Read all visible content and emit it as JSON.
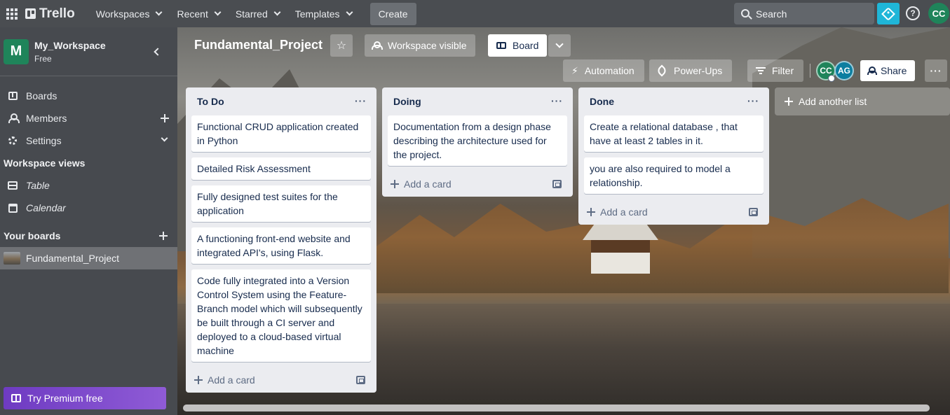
{
  "topnav": {
    "logo_text": "Trello",
    "menus": [
      "Workspaces",
      "Recent",
      "Starred",
      "Templates"
    ],
    "create_label": "Create",
    "search_placeholder": "Search",
    "user_initials": "CC"
  },
  "sidebar": {
    "workspace_initial": "M",
    "workspace_name": "My_Workspace",
    "workspace_plan": "Free",
    "items": [
      {
        "label": "Boards",
        "icon": "board-icon"
      },
      {
        "label": "Members",
        "icon": "members-icon"
      },
      {
        "label": "Settings",
        "icon": "gear-icon"
      }
    ],
    "views_title": "Workspace views",
    "views": [
      {
        "label": "Table",
        "icon": "table-icon"
      },
      {
        "label": "Calendar",
        "icon": "calendar-icon"
      }
    ],
    "boards_title": "Your boards",
    "boards": [
      {
        "label": "Fundamental_Project"
      }
    ],
    "premium_label": "Try Premium free"
  },
  "board": {
    "title": "Fundamental_Project",
    "visibility_label": "Workspace visible",
    "view_label": "Board",
    "automation_label": "Automation",
    "powerups_label": "Power-Ups",
    "filter_label": "Filter",
    "members": [
      "CC",
      "AG"
    ],
    "share_label": "Share",
    "more_label": "···",
    "add_list_label": "Add another list"
  },
  "lists": [
    {
      "title": "To Do",
      "cards": [
        "Functional CRUD application created in Python",
        "Detailed Risk Assessment",
        "Fully designed test suites for the application",
        "A functioning front-end website and integrated API's, using Flask.",
        "Code fully integrated into a Version Control System using the Feature-Branch model which will subsequently be built through a CI server and deployed to a cloud-based virtual machine"
      ],
      "add_label": "Add a card"
    },
    {
      "title": "Doing",
      "cards": [
        "Documentation from a design phase describing the architecture used for the project."
      ],
      "add_label": "Add a card"
    },
    {
      "title": "Done",
      "cards": [
        "Create a relational database , that have at least 2 tables in it.",
        "you are also required to model a relationship."
      ],
      "add_label": "Add a card"
    }
  ],
  "colors": {
    "workspace_avatar": "#1f845a",
    "premium_gradient_start": "#6e3bc2",
    "premium_gradient_end": "#8f5bd6",
    "premium_icon_bg": "#1fb6d8",
    "member_cc": "#1f845a",
    "member_ag": "#0c7ea0"
  }
}
